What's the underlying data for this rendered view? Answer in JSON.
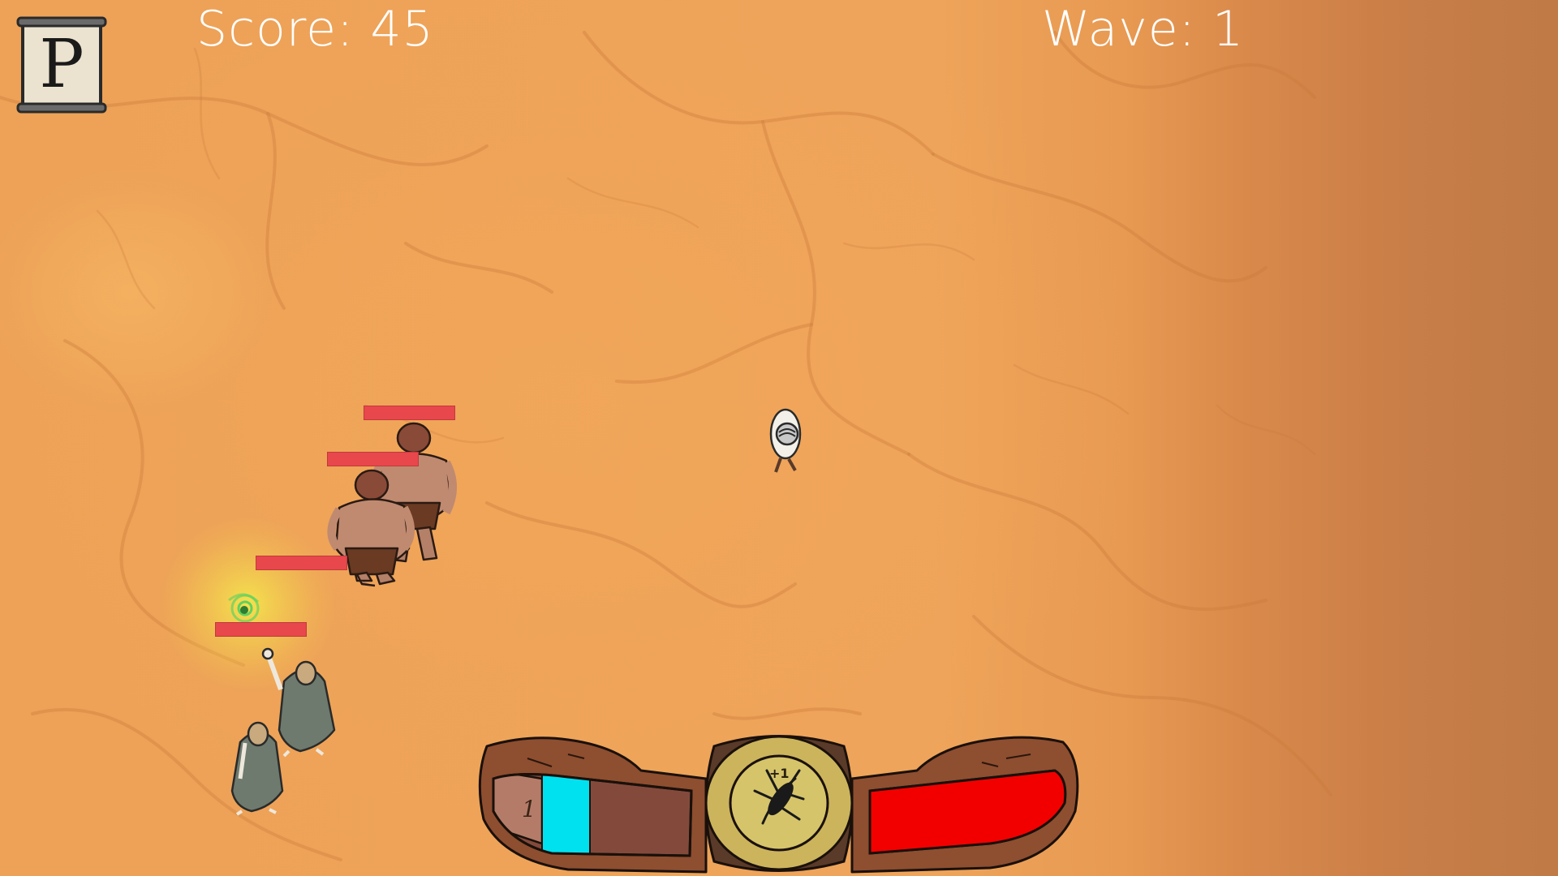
{
  "hud": {
    "score_label": "Score: 45",
    "wave_label": "Wave: 1",
    "pause_letter": "P"
  },
  "belt": {
    "stack_count": "1",
    "bonus_label": "+1",
    "mana_fraction": 0.32,
    "health_fraction": 1.0,
    "center_icon": "insect-emblem-icon"
  },
  "enemies": [
    {
      "type": "ogre",
      "health_fraction": 1.0
    },
    {
      "type": "ogre",
      "health_fraction": 1.0
    },
    {
      "type": "cultist",
      "health_fraction": 1.0
    },
    {
      "type": "cultist",
      "health_fraction": 1.0
    }
  ],
  "colors": {
    "ground": "#eb9f52",
    "health": "#e8474c",
    "mana": "#00e1f0",
    "player_health": "#f20000",
    "belt_leather": "#8a4a2a",
    "buckle_gold": "#c9b35a"
  }
}
